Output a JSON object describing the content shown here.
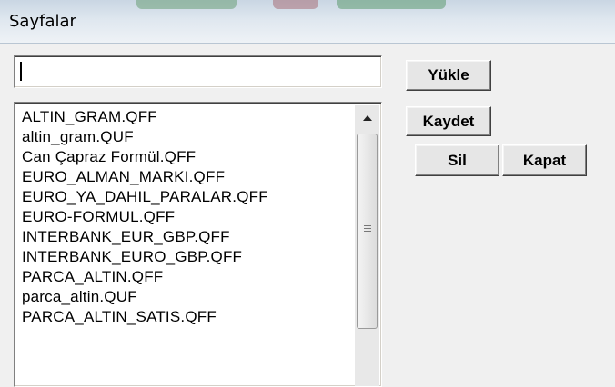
{
  "window": {
    "title": "Sayfalar"
  },
  "search": {
    "value": "",
    "placeholder": ""
  },
  "buttons": {
    "load": "Yükle",
    "save": "Kaydet",
    "delete": "Sil",
    "close": "Kapat"
  },
  "files": [
    "ALTIN_GRAM.QFF",
    "altin_gram.QUF",
    "Can Çapraz Formül.QFF",
    "EURO_ALMAN_MARKI.QFF",
    "EURO_YA_DAHIL_PARALAR.QFF",
    "EURO-FORMUL.QFF",
    "INTERBANK_EUR_GBP.QFF",
    "INTERBANK_EURO_GBP.QFF",
    "PARCA_ALTIN.QFF",
    "parca_altin.QUF",
    "PARCA_ALTIN_SATIS.QFF"
  ],
  "icons": {
    "scroll_up": "chevron-up-icon",
    "grip": "scroll-grip-icon"
  }
}
